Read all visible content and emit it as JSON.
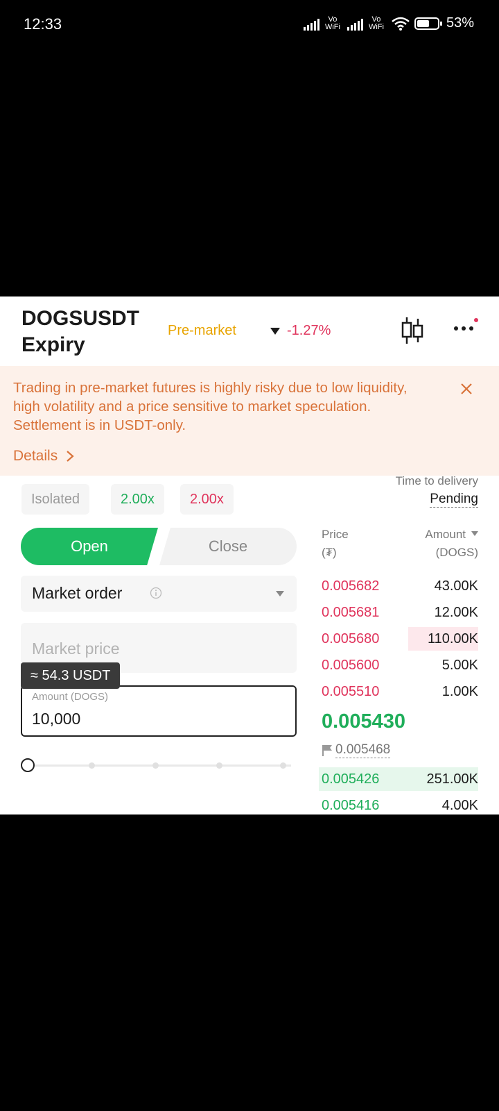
{
  "status_bar": {
    "time": "12:33",
    "network1": "Vo WiFi",
    "network2": "Vo WiFi",
    "battery": "53%",
    "icons": [
      "signal-icon",
      "wifi-icon",
      "battery-icon"
    ]
  },
  "header": {
    "symbol": "DOGSUSDT",
    "subtitle": "Expiry",
    "badge": "Pre-market",
    "change": "-1.27%",
    "icons": [
      "candlestick-chart-icon",
      "more-icon"
    ]
  },
  "warning": {
    "text": "Trading in pre-market futures is highly risky due to low liquidity, high volatility and a price sensitive to market speculation. Settlement is in USDT-only.",
    "details_label": "Details"
  },
  "margin": {
    "mode": "Isolated",
    "long_leverage": "2.00x",
    "short_leverage": "2.00x"
  },
  "delivery": {
    "label": "Time to delivery",
    "value": "Pending"
  },
  "tabs": {
    "open": "Open",
    "close": "Close"
  },
  "order": {
    "type": "Market order",
    "price_placeholder": "Market price",
    "estimate": "≈ 54.3 USDT",
    "amount_label": "Amount (DOGS)",
    "amount_value": "10,000",
    "slider_percent": 0
  },
  "orderbook": {
    "price_header": "Price",
    "price_unit": "(₮)",
    "amount_header": "Amount",
    "amount_unit": "(DOGS)",
    "asks": [
      {
        "price": "0.005682",
        "amount": "43.00K",
        "depth": 0.0
      },
      {
        "price": "0.005681",
        "amount": "12.00K",
        "depth": 0.0
      },
      {
        "price": "0.005680",
        "amount": "110.00K",
        "depth": 0.44
      },
      {
        "price": "0.005600",
        "amount": "5.00K",
        "depth": 0.0
      },
      {
        "price": "0.005510",
        "amount": "1.00K",
        "depth": 0.0
      }
    ],
    "last_price": "0.005430",
    "mark_price": "0.005468",
    "bids": [
      {
        "price": "0.005426",
        "amount": "251.00K",
        "depth": 1.0
      },
      {
        "price": "0.005416",
        "amount": "4.00K",
        "depth": 0.0
      }
    ],
    "colors": {
      "ask": "#e0345c",
      "bid": "#1fae5a"
    }
  }
}
